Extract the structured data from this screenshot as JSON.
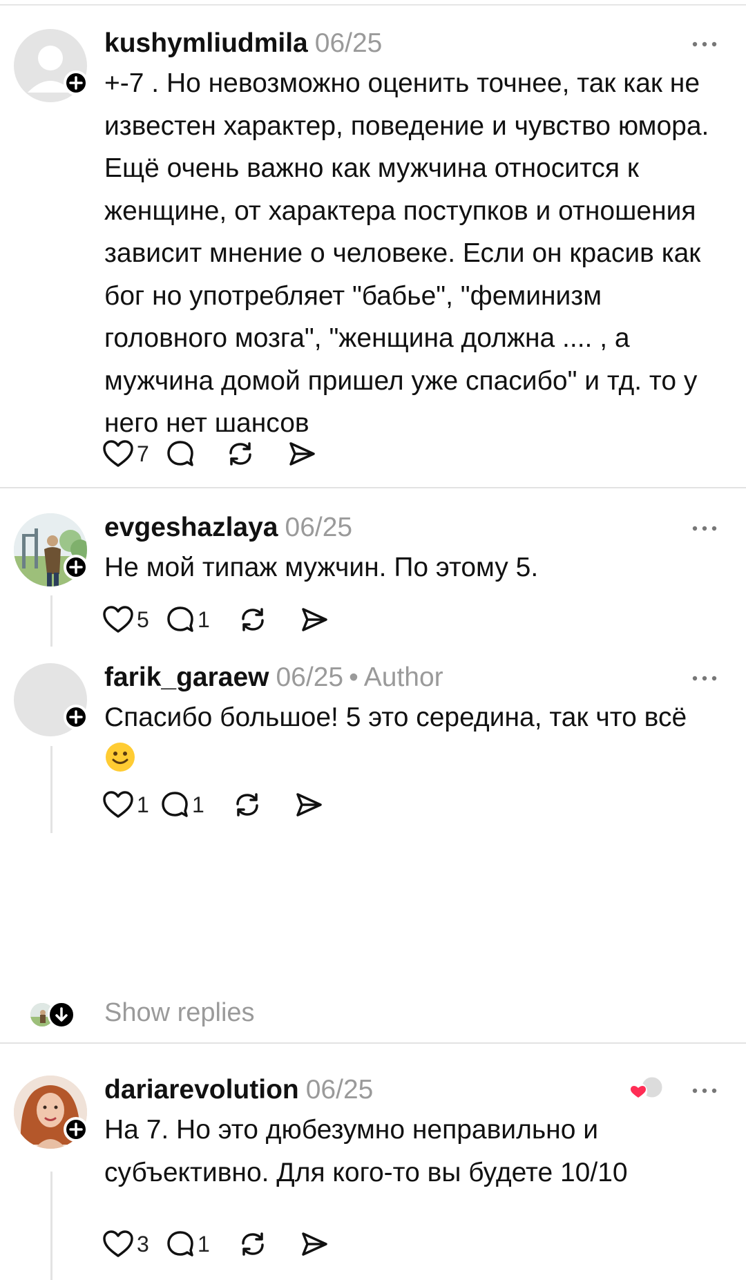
{
  "comments": [
    {
      "username": "kushymliudmila",
      "date": "06/25",
      "text": "+-7 . Но невозможно оценить точнее, так как не известен характер, поведение и чувство юмора. Ещё очень важно как мужчина относится к женщине, от характера поступков и отношения зависит мнение о человеке. Если он красив как бог но употребляет \"бабье\", \"феминизм головного мозга\", \"женщина должна .... , а мужчина домой пришел уже спасибо\" и тд. то у него нет шансов",
      "likes": "7",
      "replies": ""
    },
    {
      "username": "evgeshazlaya",
      "date": "06/25",
      "text": "Не мой типаж мужчин. По этому 5.",
      "likes": "5",
      "replies": "1"
    },
    {
      "username": "farik_garaew",
      "date": "06/25",
      "badge": "Author",
      "text": "Спасибо большое! 5 это середина, так что всё",
      "emoji": "slightly-smiling-face",
      "likes": "1",
      "replies": "1"
    },
    {
      "username": "dariarevolution",
      "date": "06/25",
      "text": "На 7. Но это дюбезумно неправильно и субъективно. Для кого-то вы будете 10/10",
      "likes": "3",
      "replies": "1"
    }
  ],
  "show_replies_label": "Show replies",
  "colors": {
    "muted": "#9a9a9a",
    "accent": "#000000",
    "heart_red": "#ff2d55",
    "emoji_yellow": "#ffcc33"
  }
}
